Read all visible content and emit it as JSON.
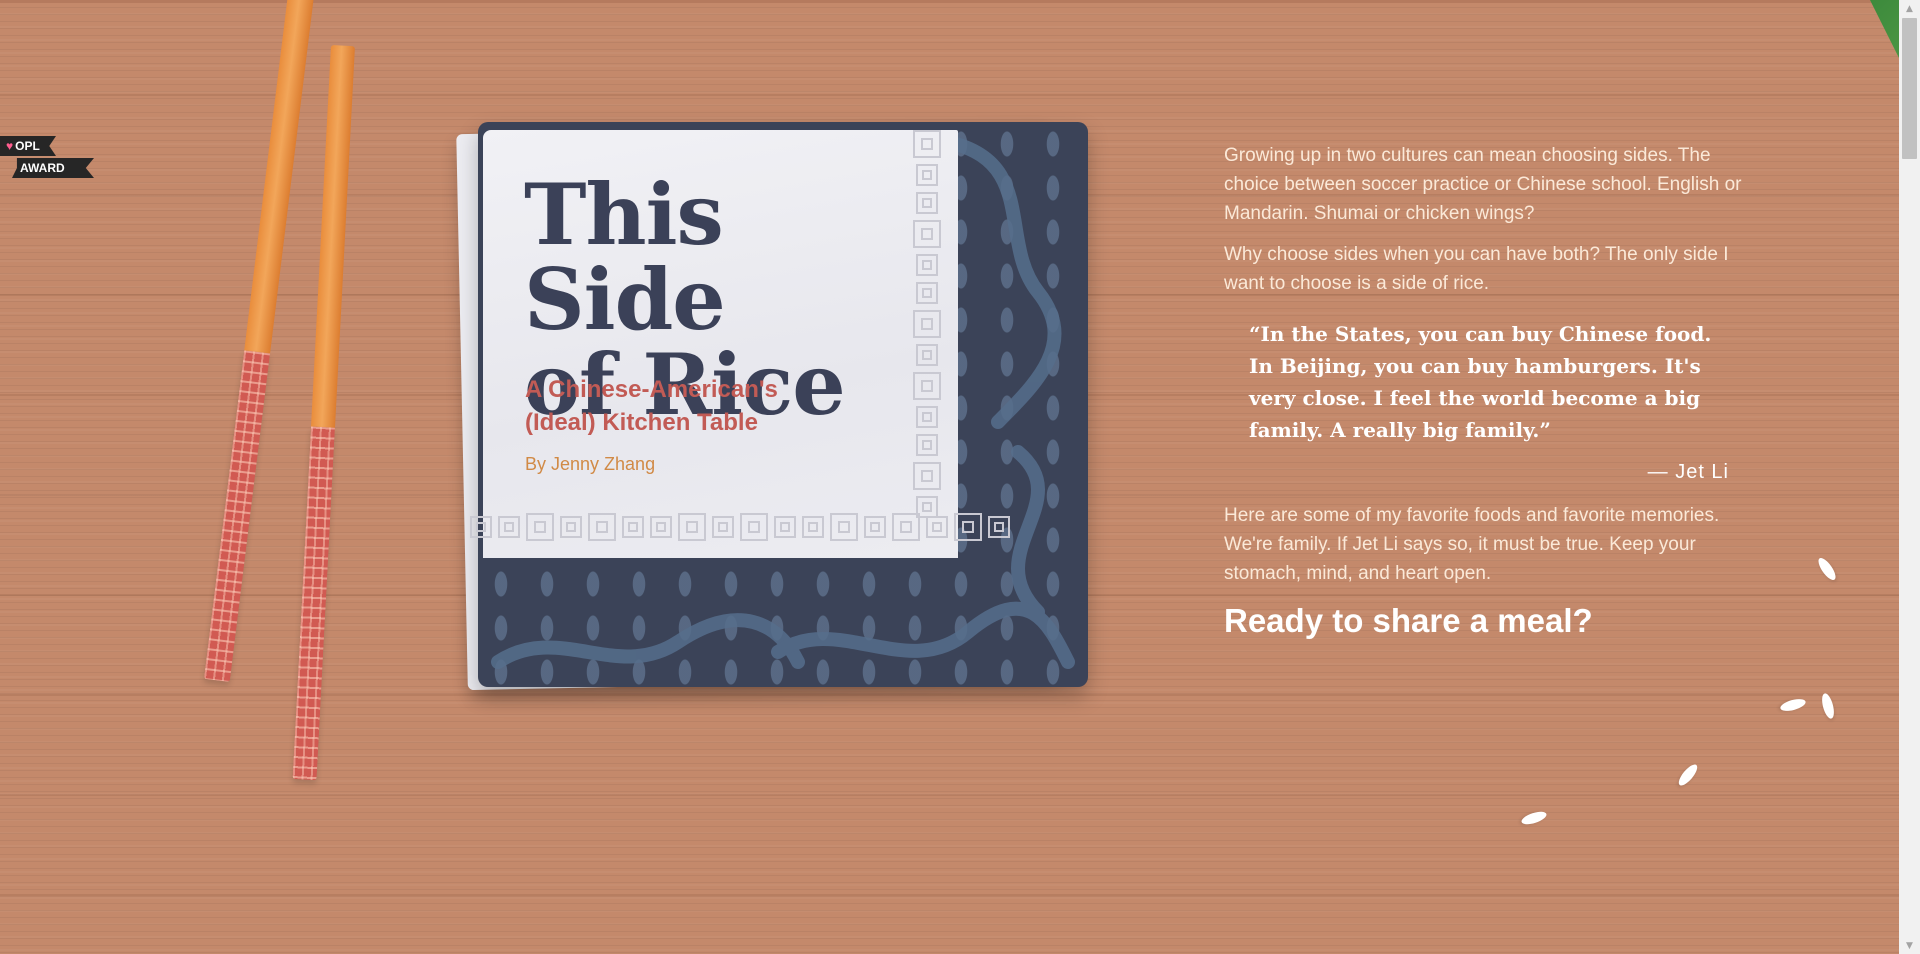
{
  "award": {
    "line1": "OPL",
    "line2": "AWARD",
    "heart_icon": "heart-icon"
  },
  "book": {
    "title_line1": "This Side",
    "title_line2": "of Rice",
    "subtitle_line1": "A Chinese-American's",
    "subtitle_line2": "(Ideal) Kitchen Table",
    "byline": "By Jenny Zhang"
  },
  "intro": {
    "para1": "Growing up in two cultures can mean choosing sides. The choice between soccer practice or Chinese school. English or Mandarin. Shumai or chicken wings?",
    "para2": "Why choose sides when you can have both? The only side I want to choose is a side of rice.",
    "quote": "“In the States, you can buy Chinese food. In Beijing, you can buy hamburgers. It's very close. I feel the world become a big family. A really big family.”",
    "quote_attribution": "— Jet Li",
    "para3": "Here are some of my favorite foods and favorite memories. We're family. If Jet Li says so, it must be true. Keep your stomach, mind, and heart open.",
    "cta": "Ready to share a meal?"
  },
  "colors": {
    "wood": "#c4896b",
    "navy": "#3b4358",
    "title": "#3b4158",
    "subtitle": "#c25b55",
    "byline": "#d18a46",
    "text": "#fbe9d8"
  },
  "scrollbar": {
    "up_icon": "arrow-up-icon",
    "down_icon": "arrow-down-icon"
  }
}
